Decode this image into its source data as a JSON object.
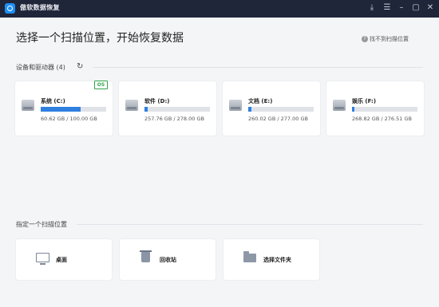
{
  "window": {
    "title": "傲软数据恢复"
  },
  "header": {
    "title": "选择一个扫描位置，开始恢复数据",
    "help_link": "找不到扫描位置"
  },
  "devices": {
    "section_title": "设备和驱动器 (4)",
    "drives": [
      {
        "name": "系统 (C:)",
        "size": "60.62 GB / 100.00 GB",
        "used_fraction": 0.61,
        "badge": "OS"
      },
      {
        "name": "软件 (D:)",
        "size": "257.76 GB / 278.00 GB",
        "used_fraction": 0.05
      },
      {
        "name": "文档 (E:)",
        "size": "260.02 GB / 277.00 GB",
        "used_fraction": 0.05
      },
      {
        "name": "娱乐 (F:)",
        "size": "268.82 GB / 276.51 GB",
        "used_fraction": 0.04
      }
    ]
  },
  "locations": {
    "section_title": "指定一个扫描位置",
    "items": [
      {
        "label": "桌面",
        "icon": "monitor-icon"
      },
      {
        "label": "回收站",
        "icon": "recycle-bin-icon"
      },
      {
        "label": "选择文件夹",
        "icon": "folder-icon"
      }
    ]
  },
  "colors": {
    "titlebar": "#20263a",
    "accent": "#2f7fe0",
    "os_badge": "#36a34e"
  }
}
